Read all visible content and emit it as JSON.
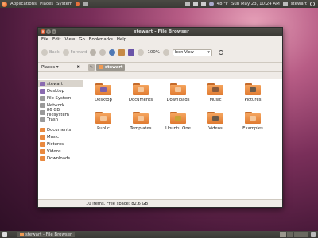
{
  "top_panel": {
    "menus": [
      "Applications",
      "Places",
      "System"
    ],
    "temperature": "48 °F",
    "datetime": "Sun May 23, 10:24 AM",
    "user": "stewart"
  },
  "window": {
    "title": "stewart - File Browser",
    "menubar": [
      "File",
      "Edit",
      "View",
      "Go",
      "Bookmarks",
      "Help"
    ],
    "toolbar": {
      "back_label": "Back",
      "forward_label": "Forward",
      "zoom": "100%",
      "view_mode": "Icon View"
    },
    "places_label": "Places ▾",
    "location": "stewart",
    "sidebar": [
      {
        "label": "stewart",
        "icon": "home-icon",
        "color": "#8a6bb0"
      },
      {
        "label": "Desktop",
        "icon": "desktop-icon",
        "color": "#8a6bb0"
      },
      {
        "label": "File System",
        "icon": "drive-icon",
        "color": "#9a9a9a"
      },
      {
        "label": "Network",
        "icon": "network-icon",
        "color": "#9a9a9a"
      },
      {
        "label": "86 GB Filesystem",
        "icon": "drive-icon",
        "color": "#9a9a9a"
      },
      {
        "label": "Trash",
        "icon": "trash-icon",
        "color": "#9a9a9a"
      },
      {
        "label": "Documents",
        "icon": "folder-icon",
        "color": "#e9893f"
      },
      {
        "label": "Music",
        "icon": "folder-icon",
        "color": "#e9893f"
      },
      {
        "label": "Pictures",
        "icon": "folder-icon",
        "color": "#e9893f"
      },
      {
        "label": "Videos",
        "icon": "folder-icon",
        "color": "#e9893f"
      },
      {
        "label": "Downloads",
        "icon": "folder-icon",
        "color": "#e9893f"
      }
    ],
    "files": [
      {
        "name": "Desktop",
        "emblem": "#7b5ea8"
      },
      {
        "name": "Documents",
        "emblem": "#f5c79b"
      },
      {
        "name": "Downloads",
        "emblem": "#f5c79b"
      },
      {
        "name": "Music",
        "emblem": "#8a5a3a"
      },
      {
        "name": "Pictures",
        "emblem": "#6a5a4a"
      },
      {
        "name": "Public",
        "emblem": "#f5c79b"
      },
      {
        "name": "Templates",
        "emblem": "#f5c79b"
      },
      {
        "name": "Ubuntu One",
        "emblem": "#c9a234"
      },
      {
        "name": "Videos",
        "emblem": "#6a5a4a"
      },
      {
        "name": "Examples",
        "emblem": "#f5c79b"
      }
    ],
    "status": "10 items, Free space: 82.6 GB"
  },
  "bottom_panel": {
    "task_label": "stewart - File Browser"
  }
}
